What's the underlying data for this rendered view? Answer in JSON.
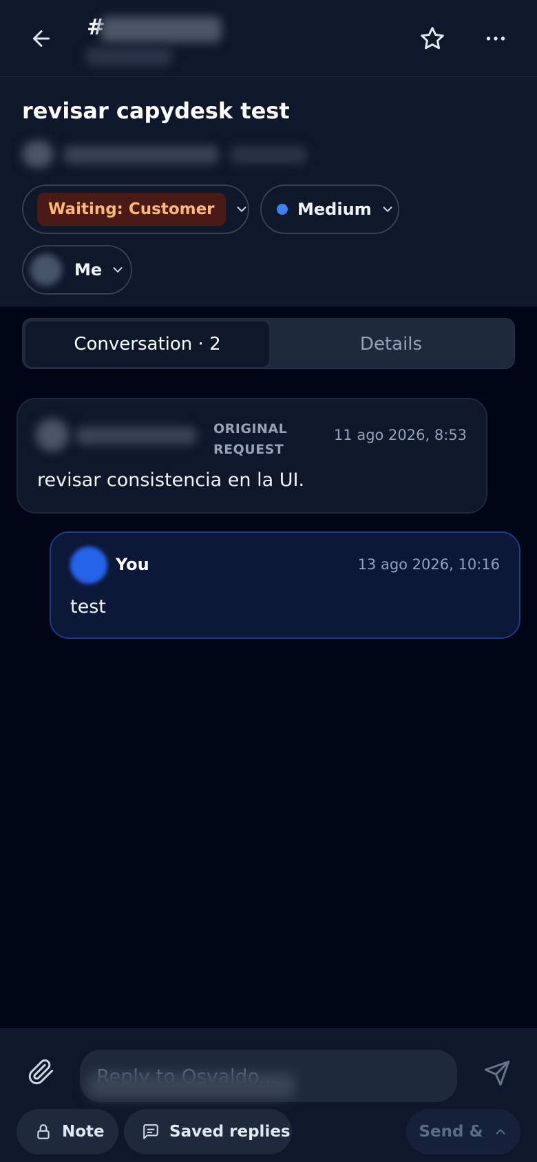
{
  "header": {
    "ticket_prefix": "#",
    "title": "revisar capydesk test"
  },
  "ticket": {
    "status": "Waiting: Customer",
    "priority": "Medium",
    "assignee": "Me"
  },
  "tabs": {
    "conversation": "Conversation · 2",
    "details": "Details"
  },
  "messages": [
    {
      "badge": "ORIGINAL\nREQUEST",
      "time": "11 ago 2026, 8:53",
      "body": "revisar consistencia en la UI."
    },
    {
      "author": "You",
      "time": "13 ago 2026, 10:16",
      "body": "test"
    }
  ],
  "composer": {
    "placeholder": "Reply to Osvaldo...",
    "note_label": "Note",
    "saved_replies_label": "Saved replies",
    "send_and_label": "Send &"
  },
  "colors": {
    "background": "#010617",
    "panel": "#0f172a",
    "status_bg": "#4a1a17",
    "status_text": "#fdba74",
    "priority_dot": "#3b82f6",
    "reply_bg": "#0c1838"
  }
}
